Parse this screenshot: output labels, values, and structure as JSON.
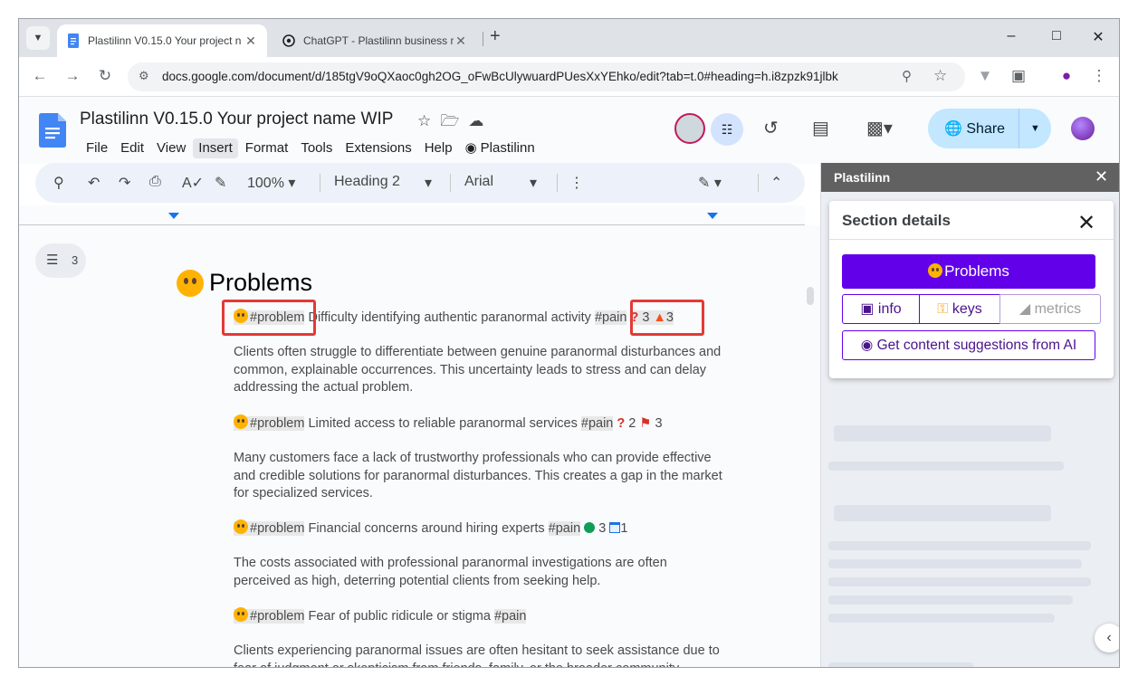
{
  "browser": {
    "tabs": [
      {
        "title": "Plastilinn V0.15.0 Your project n",
        "active": true
      },
      {
        "title": "ChatGPT - Plastilinn business m",
        "active": false
      }
    ],
    "url": "docs.google.com/document/d/185tgV9oQXaoc0gh2OG_oFwBcUlywuardPUesXxYEhko/edit?tab=t.0#heading=h.i8zpzk91jlbk"
  },
  "doc": {
    "title": "Plastilinn V0.15.0 Your project name WIP",
    "menu": [
      "File",
      "Edit",
      "View",
      "Insert",
      "Format",
      "Tools",
      "Extensions",
      "Help",
      "Plastilinn"
    ],
    "share_label": "Share"
  },
  "toolbar": {
    "zoom": "100%",
    "style": "Heading 2",
    "font": "Arial"
  },
  "outline_count": "3",
  "content": {
    "heading": "Problems",
    "items": [
      {
        "tag": "#problem",
        "title": " Difficulty identifying authentic paranormal activity ",
        "pain": "#pain",
        "m1": "3",
        "m2": "3",
        "desc": "Clients often struggle to differentiate between genuine paranormal disturbances and common, explainable occurrences. This uncertainty leads to stress and can delay addressing the actual problem."
      },
      {
        "tag": "#problem",
        "title": " Limited access to reliable paranormal services ",
        "pain": "#pain",
        "m1": "2",
        "m2": "3",
        "desc": "Many customers face a lack of trustworthy professionals who can provide effective and credible solutions for paranormal disturbances. This creates a gap in the market for specialized services."
      },
      {
        "tag": "#problem",
        "title": " Financial concerns around hiring experts ",
        "pain": "#pain",
        "m1": "3",
        "m2": "1",
        "desc": "The costs associated with professional paranormal investigations are often perceived as high, deterring potential clients from seeking help."
      },
      {
        "tag": "#problem",
        "title": " Fear of public ridicule or stigma ",
        "pain": "#pain",
        "desc": "Clients experiencing paranormal issues are often hesitant to seek assistance due to fear of judgment or skepticism from friends, family, or the broader community."
      }
    ]
  },
  "panel": {
    "title": "Plastilinn",
    "card_title": "Section details",
    "section_button": "Problems",
    "tabs": [
      "info",
      "keys",
      "metrics"
    ],
    "ai_button": "Get content suggestions from AI"
  }
}
